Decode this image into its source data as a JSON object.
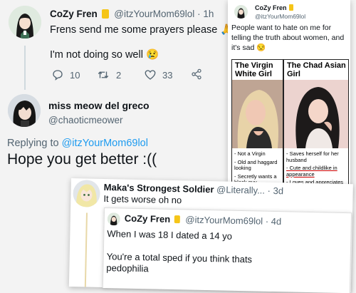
{
  "tweet1": {
    "display_name": "CoZy Fren",
    "handle": "@itzYourMom69lol",
    "time": "· 1h",
    "line1": "Frens send me some prayers please 🙏",
    "line2": "I'm not doing so well 😢",
    "replies": "10",
    "retweets": "2",
    "likes": "33",
    "icons": [
      "reply-icon",
      "retweet-icon",
      "heart-icon",
      "share-icon"
    ]
  },
  "reply1": {
    "display_name": "miss meow del greco",
    "handle": "@chaoticmeower",
    "replying_prefix": "Replying to",
    "replying_handle": "@itzYourMom69lol",
    "text": "Hope you get better :(("
  },
  "quote_card": {
    "display_name": "CoZy Fren",
    "handle": "@itzYourMom69lol",
    "text": "People want to hate on me for telling the truth about women, and it's sad 😒",
    "meme": {
      "left_title": "The Virgin White Girl",
      "right_title": "The Chad Asian Girl",
      "left_items": [
        "- Not a Virgin",
        "- Old and haggard looking",
        "- Secretly wants a black guy"
      ],
      "right_items": [
        "- Saves herself for her husband",
        "- Cute and childlike in appearance",
        "- Loves and appreciates her white boyfriend"
      ]
    }
  },
  "reply2": {
    "display_name": "Maka's Strongest Soldier",
    "handle": "@Literally...",
    "time": "· 3d",
    "text": "It gets worse oh no"
  },
  "embedded": {
    "display_name": "CoZy Fren",
    "handle": "@itzYourMom69lol",
    "time": "· 4d",
    "line1": "When I was 18 I dated a 14 yo",
    "line2": "You're a total sped if you think thats pedophilia"
  },
  "colors": {
    "accent": "#1d9bf0",
    "muted": "#536471",
    "verified_badge": "#f5c518"
  }
}
